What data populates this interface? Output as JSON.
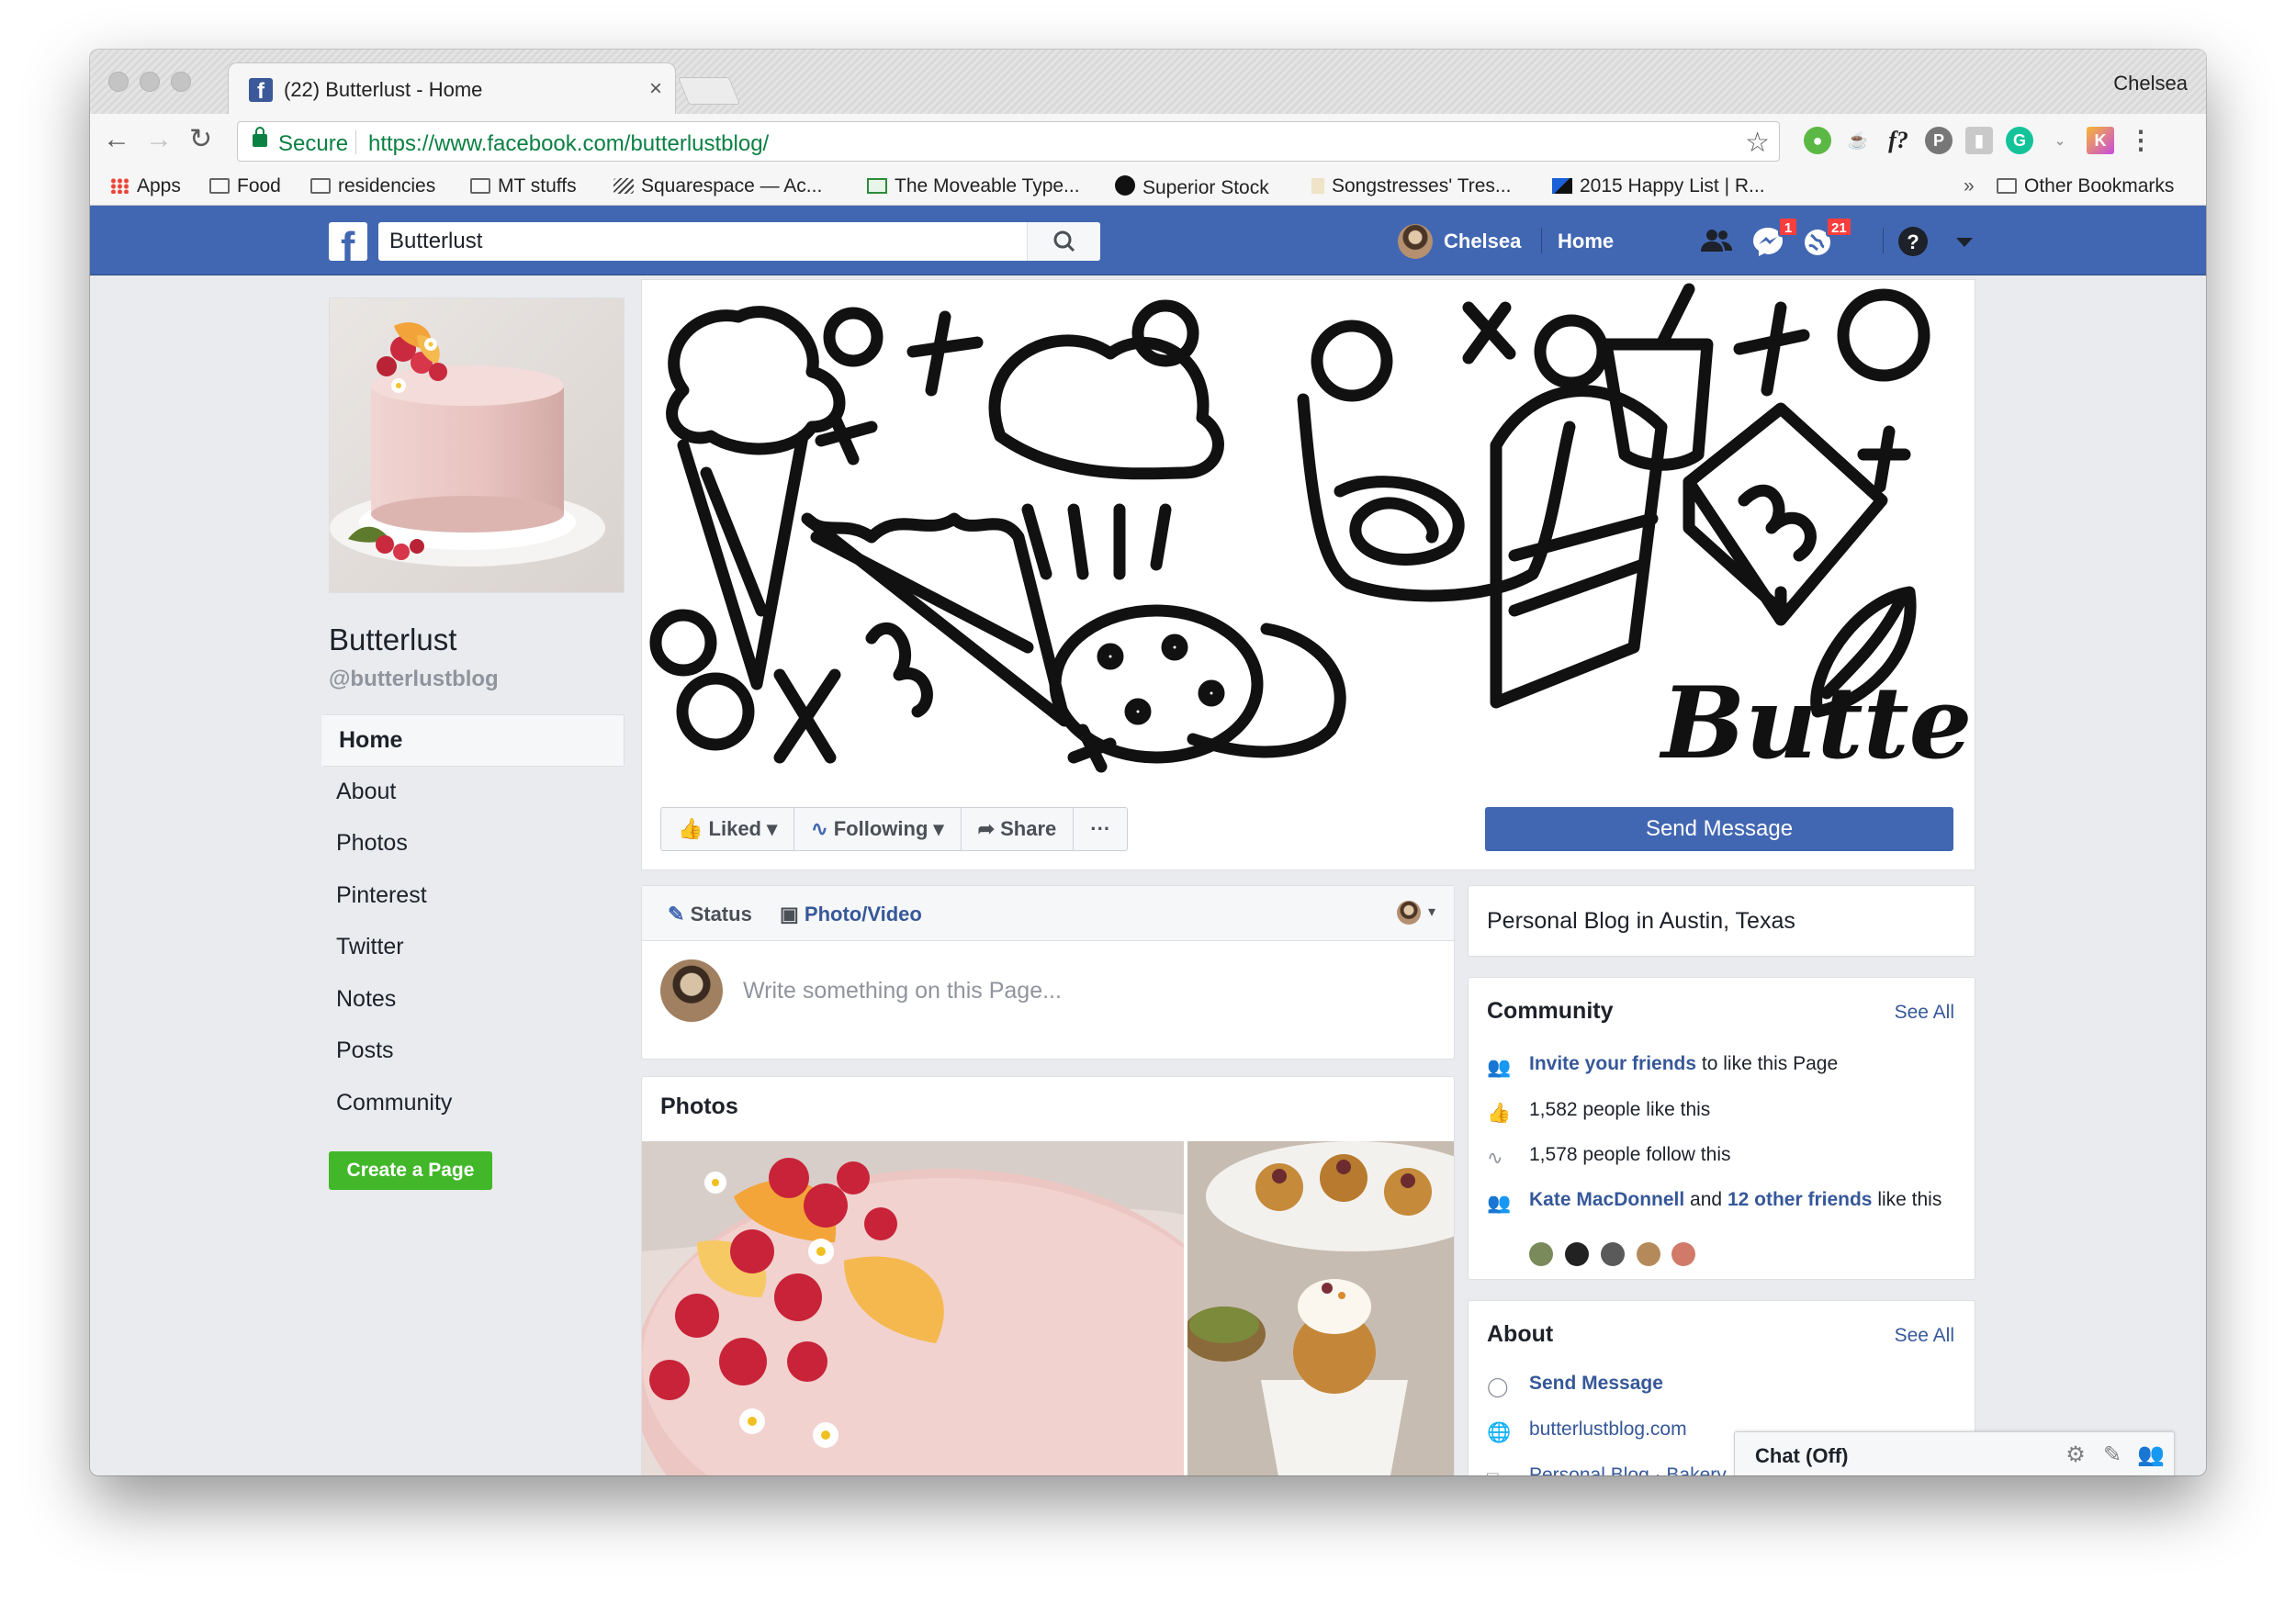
{
  "browser": {
    "tab_title": "(22) Butterlust - Home",
    "tab_close": "×",
    "profile_name": "Chelsea",
    "secure_label": "Secure",
    "url": "https://www.facebook.com/butterlustblog/",
    "bookmarks": [
      "Apps",
      "Food",
      "residencies",
      "MT stuffs",
      "Squarespace — Ac...",
      "The Moveable Type...",
      "Superior Stock",
      "Songstresses' Tres...",
      "2015 Happy List | R...",
      "»",
      "Other Bookmarks"
    ],
    "extension_icons": [
      "evernote-icon",
      "tea-icon",
      "font-icon",
      "pinterest-icon",
      "bookmark-icon",
      "grammarly-icon",
      "kindle-icon",
      "menu-icon"
    ],
    "font_ext_label": "f?"
  },
  "fb": {
    "search_value": "Butterlust",
    "user_name": "Chelsea",
    "home_label": "Home",
    "messages_badge": "1",
    "notifications_badge": "21"
  },
  "page": {
    "name": "Butterlust",
    "handle": "@butterlustblog",
    "nav": [
      "Home",
      "About",
      "Photos",
      "Pinterest",
      "Twitter",
      "Notes",
      "Posts",
      "Community"
    ],
    "create_page": "Create a Page",
    "cover_text": "Butterlust"
  },
  "actions": {
    "liked": "Liked",
    "following": "Following",
    "share": "Share",
    "more": "···",
    "send_message": "Send Message"
  },
  "composer": {
    "status_tab": "Status",
    "photo_tab": "Photo/Video",
    "placeholder": "Write something on this Page..."
  },
  "photos": {
    "heading": "Photos"
  },
  "category": "Personal Blog in Austin, Texas",
  "community": {
    "heading": "Community",
    "see_all": "See All",
    "invite_link": "Invite your friends",
    "invite_rest": "to like this Page",
    "likes": "1,582 people like this",
    "follows": "1,578 people follow this",
    "friend_name": "Kate MacDonnell",
    "and_text": "and",
    "friends_count": "12 other friends",
    "like_this": "like this"
  },
  "about": {
    "heading": "About",
    "see_all": "See All",
    "send_message": "Send Message",
    "website": "butterlustblog.com",
    "category_links": "Personal Blog · Bakery"
  },
  "chat": {
    "label": "Chat (Off)"
  },
  "colors": {
    "fb_blue": "#4267b2",
    "link": "#365899",
    "green": "#42b72a",
    "notification_red": "#fa3e3e"
  }
}
